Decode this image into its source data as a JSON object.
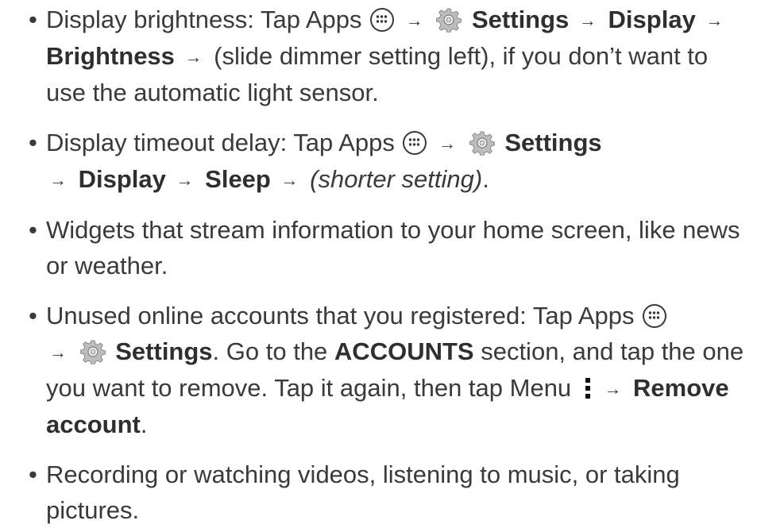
{
  "bullets": {
    "brightness": {
      "prefix": "Display brightness: Tap Apps",
      "settings": "Settings",
      "display": "Display",
      "brightness": "Brightness",
      "suffix": " (slide dimmer setting left), if you don’t want to use the automatic light sensor."
    },
    "timeout": {
      "prefix": "Display timeout delay: Tap Apps",
      "settings": "Settings",
      "display": "Display",
      "sleep": "Sleep",
      "shorter": "(shorter setting)",
      "end": "."
    },
    "widgets": {
      "text": "Widgets that stream information to your home screen, like news or weather."
    },
    "accounts": {
      "prefix": "Unused online accounts that you registered: Tap Apps",
      "settings": "Settings",
      "mid1": ". Go to the ",
      "accounts": "ACCOUNTS",
      "mid2": " section, and tap the one you want to remove. Tap it again, then tap Menu",
      "remove": "Remove account",
      "end": "."
    },
    "media": {
      "text": "Recording or watching videos, listening to music, or taking pictures."
    }
  },
  "symbols": {
    "arrow": "→"
  },
  "icons": [
    "apps-icon",
    "gear-icon",
    "menu-icon"
  ],
  "colors": {
    "text": "#3a3a3a",
    "bold": "#2f2f2f",
    "icon": "#9a9a9a"
  }
}
